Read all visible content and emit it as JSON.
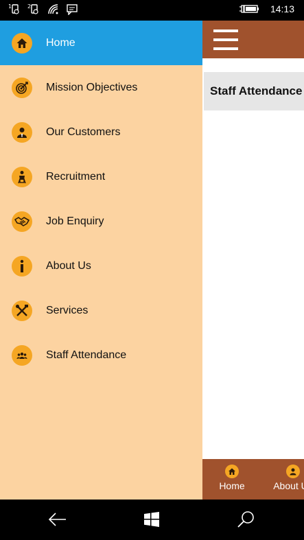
{
  "status_bar": {
    "time": "14:13",
    "icons": [
      "sim1-icon",
      "sim2-icon",
      "wifi-icon",
      "message-icon",
      "battery-charging-icon"
    ]
  },
  "drawer": {
    "items": [
      {
        "label": "Home",
        "icon": "home-icon",
        "active": true
      },
      {
        "label": "Mission Objectives",
        "icon": "target-icon",
        "active": false
      },
      {
        "label": "Our Customers",
        "icon": "person-icon",
        "active": false
      },
      {
        "label": "Recruitment",
        "icon": "recruitment-icon",
        "active": false
      },
      {
        "label": "Job Enquiry",
        "icon": "handshake-icon",
        "active": false
      },
      {
        "label": "About Us",
        "icon": "info-icon",
        "active": false
      },
      {
        "label": "Services",
        "icon": "tools-icon",
        "active": false
      },
      {
        "label": "Staff Attendance",
        "icon": "group-icon",
        "active": false
      }
    ]
  },
  "main": {
    "card_title": "Staff Attendance"
  },
  "bottom_bar": {
    "items": [
      {
        "label": "Home",
        "icon": "home-icon"
      },
      {
        "label": "About Us",
        "icon": "person-icon"
      }
    ]
  },
  "colors": {
    "drawer_bg": "#fcd3a1",
    "active_bg": "#1f9ee0",
    "icon_bg": "#f5a623",
    "brand_brown": "#a0522d"
  },
  "nav_bar": {
    "buttons": [
      "back-icon",
      "windows-icon",
      "search-icon"
    ]
  }
}
